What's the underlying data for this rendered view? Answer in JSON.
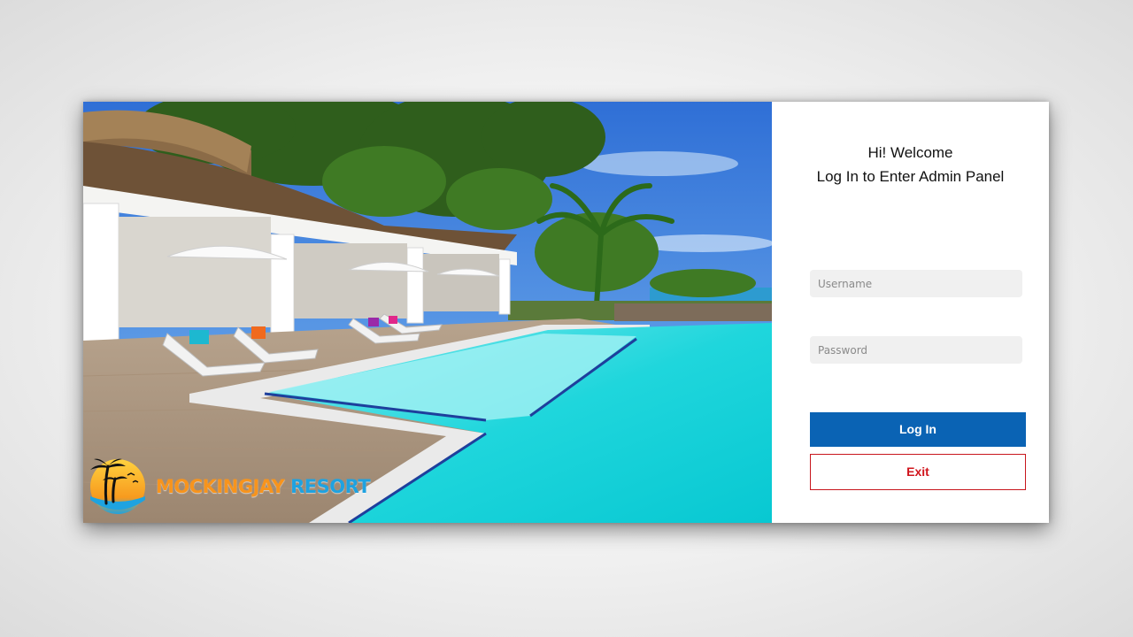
{
  "brand": {
    "name_part1": "MOCKINGJAY",
    "name_part2": "RESORT",
    "colors": {
      "orange": "#f7941d",
      "blue": "#1fa2e0"
    }
  },
  "hero": {
    "image": "resort-pool-photo"
  },
  "login": {
    "welcome_line1": "Hi! Welcome",
    "welcome_line2": "Log In to Enter Admin Panel",
    "username_placeholder": "Username",
    "username_value": "",
    "password_placeholder": "Password",
    "password_value": "",
    "login_label": "Log In",
    "exit_label": "Exit",
    "colors": {
      "login_bg": "#0a63b4",
      "exit_border": "#c8161d"
    }
  }
}
